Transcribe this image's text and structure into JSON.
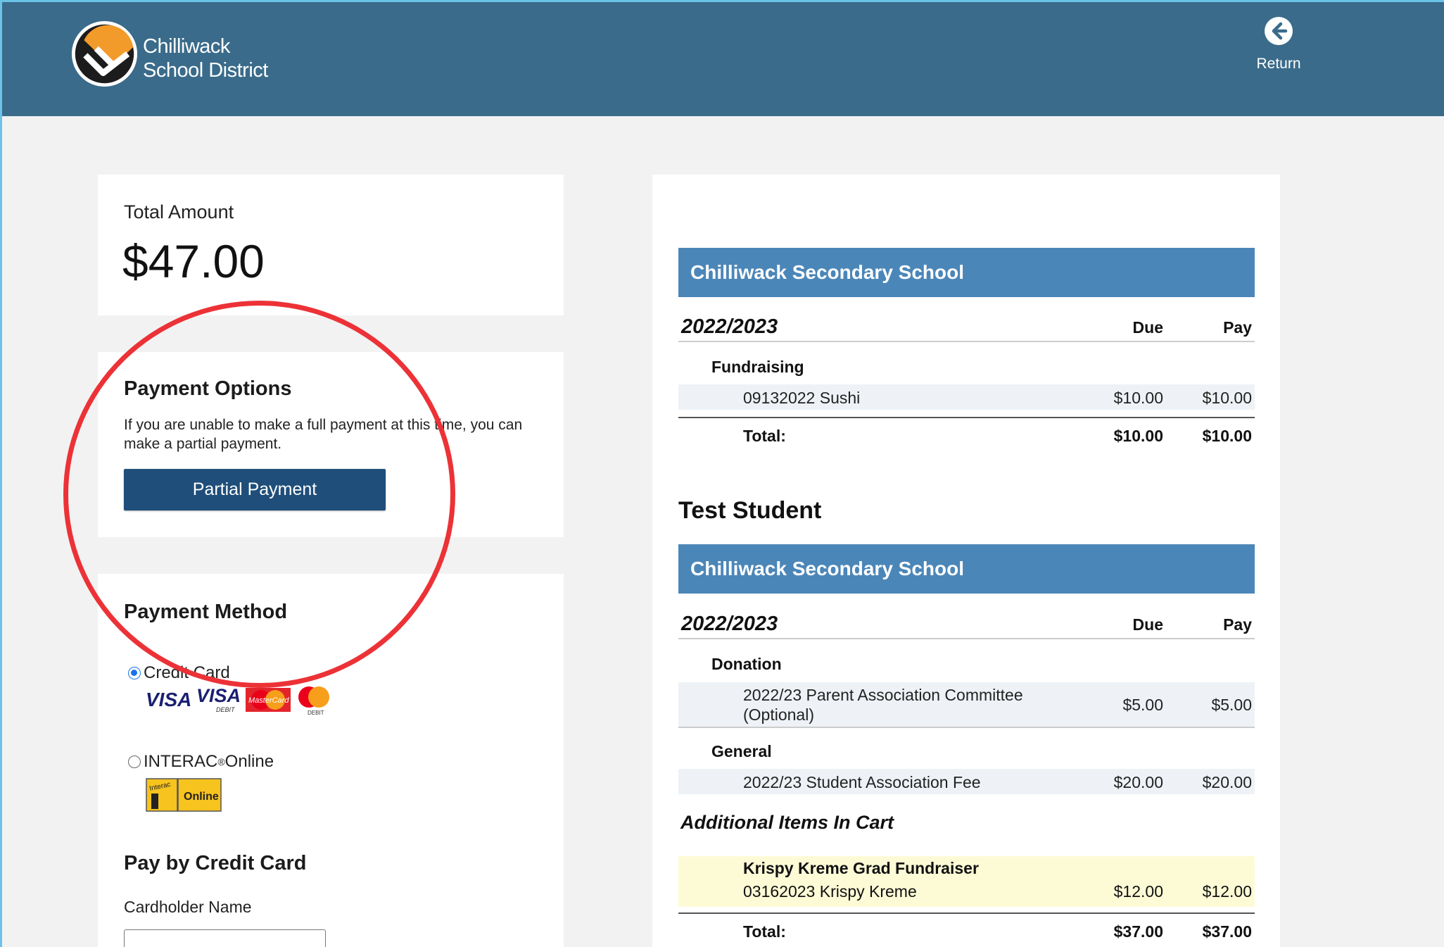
{
  "header": {
    "brand_line1": "Chilliwack",
    "brand_line2": "School District",
    "return_label": "Return",
    "bar_color": "#3a6b8a"
  },
  "summary": {
    "total_label": "Total Amount",
    "total_amount": "$47.00"
  },
  "payment_options": {
    "heading": "Payment Options",
    "description": "If you are unable to make a full payment at this time, you can make a partial payment.",
    "partial_button": "Partial Payment"
  },
  "payment_method": {
    "heading": "Payment Method",
    "options": [
      {
        "label": "Credit Card",
        "selected": true,
        "logos": [
          "visa-icon",
          "visa-debit-icon",
          "mastercard-icon",
          "mastercard-debit-icon"
        ]
      },
      {
        "label": "INTERAC",
        "trademark": "®",
        "suffix": " Online",
        "selected": false,
        "logos": [
          "interac-online-icon"
        ]
      }
    ],
    "interac_logo_text": "Online",
    "interac_logo_small": "Interac"
  },
  "card_logos": {
    "visa": "VISA",
    "visa_debit": "VISA",
    "visa_debit_sub": "DEBIT",
    "mastercard": "MasterCard",
    "mastercard_debit_sub": "DEBIT"
  },
  "credit_card": {
    "heading": "Pay by Credit Card",
    "cardholder_label": "Cardholder Name",
    "cardholder_value": ""
  },
  "cart": {
    "columns": {
      "due": "Due",
      "pay": "Pay"
    },
    "section1": {
      "school": "Chilliwack Secondary School",
      "year": "2022/2023",
      "category": "Fundraising",
      "items": [
        {
          "name": "09132022 Sushi",
          "due": "$10.00",
          "pay": "$10.00"
        }
      ],
      "total": {
        "label": "Total:",
        "due": "$10.00",
        "pay": "$10.00"
      }
    },
    "student_name": "Test Student",
    "section2": {
      "school": "Chilliwack Secondary School",
      "year": "2022/2023",
      "categories": [
        {
          "name": "Donation",
          "items": [
            {
              "name": "2022/23 Parent Association Committee (Optional)",
              "due": "$5.00",
              "pay": "$5.00"
            }
          ]
        },
        {
          "name": "General",
          "items": [
            {
              "name": "2022/23 Student Association Fee",
              "due": "$20.00",
              "pay": "$20.00"
            }
          ]
        }
      ]
    },
    "additional": {
      "heading": "Additional Items In Cart",
      "item_title": "Krispy Kreme Grad Fundraiser",
      "item_name": "03162023 Krispy Kreme",
      "due": "$12.00",
      "pay": "$12.00"
    },
    "total2": {
      "label": "Total:",
      "due": "$37.00",
      "pay": "$37.00"
    }
  },
  "colors": {
    "section_header": "#4b86b8",
    "button": "#1f4e7a",
    "annotation_circle": "#ec3237",
    "cart_highlight": "#fdfbd6"
  }
}
